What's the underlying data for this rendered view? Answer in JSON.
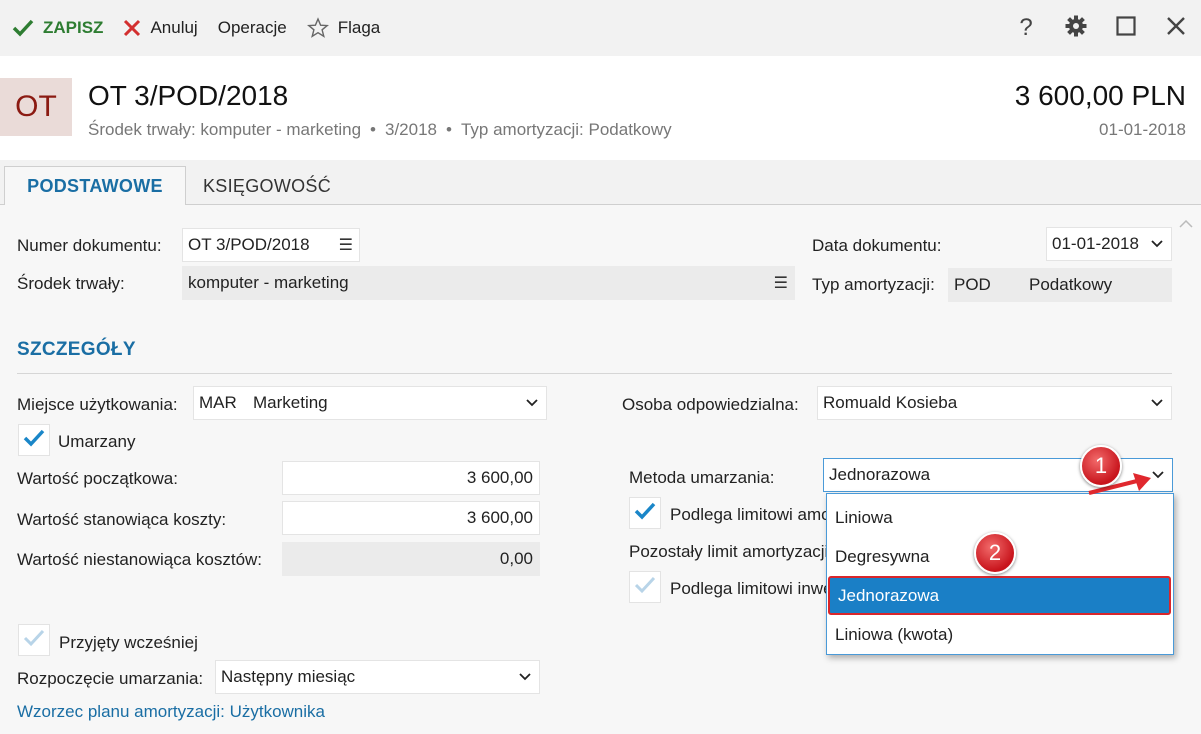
{
  "toolbar": {
    "save_label": "ZAPISZ",
    "cancel_label": "Anuluj",
    "operations_label": "Operacje",
    "flag_label": "Flaga"
  },
  "header": {
    "badge": "OT",
    "title": "OT 3/POD/2018",
    "subtitle_asset": "Środek trwały: komputer - marketing",
    "subtitle_number": "3/2018",
    "subtitle_type": "Typ amortyzacji: Podatkowy",
    "amount": "3 600,00 PLN",
    "date": "01-01-2018"
  },
  "tabs": [
    {
      "label": "PODSTAWOWE",
      "active": true
    },
    {
      "label": "KSIĘGOWOŚĆ",
      "active": false
    }
  ],
  "form": {
    "doc_number_label": "Numer dokumentu:",
    "doc_number_value": "OT 3/POD/2018",
    "asset_label": "Środek trwały:",
    "asset_value": "komputer - marketing",
    "doc_date_label": "Data dokumentu:",
    "doc_date_value": "01-01-2018",
    "dep_type_label": "Typ amortyzacji:",
    "dep_type_code": "POD",
    "dep_type_name": "Podatkowy",
    "section_title": "SZCZEGÓŁY",
    "place_label": "Miejsce użytkowania:",
    "place_code": "MAR",
    "place_name": "Marketing",
    "person_label": "Osoba odpowiedzialna:",
    "person_value": "Romuald Kosieba",
    "depreciated_label": "Umarzany",
    "initial_value_label": "Wartość początkowa:",
    "initial_value": "3 600,00",
    "cost_value_label": "Wartość stanowiąca koszty:",
    "cost_value": "3 600,00",
    "noncost_value_label": "Wartość niestanowiąca kosztów:",
    "noncost_value": "0,00",
    "method_label": "Metoda umarzania:",
    "method_value": "Jednorazowa",
    "limit_label": "Podlega limitowi amortyzacji",
    "remaining_limit_label": "Pozostały limit amortyzacji",
    "invest_limit_label": "Podlega limitowi inwestycji",
    "accepted_label": "Przyjęty wcześniej",
    "start_label": "Rozpoczęcie umarzania:",
    "start_value": "Następny miesiąc",
    "plan_link": "Wzorzec planu amortyzacji: Użytkownika"
  },
  "dropdown": {
    "options": [
      "Liniowa",
      "Degresywna",
      "Jednorazowa",
      "Liniowa (kwota)"
    ],
    "selected": "Jednorazowa"
  },
  "callouts": [
    "1",
    "2"
  ],
  "colors": {
    "accent": "#1a6ea4",
    "save_green": "#2e7d32",
    "cancel_red": "#d32f2f",
    "badge_bg": "#eadbd8",
    "badge_fg": "#8b1a12",
    "selected_bg": "#1a7fc6",
    "callout_red": "#d9262b"
  }
}
